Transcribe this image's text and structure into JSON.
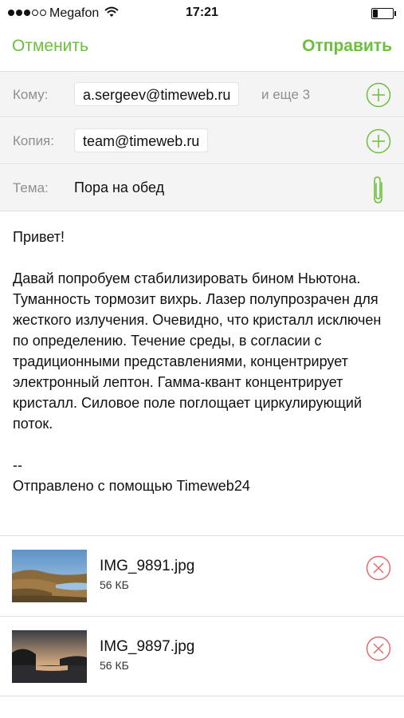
{
  "status_bar": {
    "carrier": "Megafon",
    "time": "17:21",
    "signal_bars": 3,
    "signal_total": 5,
    "battery_level": 0.2,
    "icons": [
      "signal-dots-icon",
      "wifi-icon",
      "battery-icon"
    ]
  },
  "nav": {
    "cancel_label": "Отменить",
    "send_label": "Отправить",
    "accent_color": "#6cbf3c"
  },
  "to": {
    "label": "Кому:",
    "recipient": "a.sergeev@timeweb.ru",
    "more": "и еще 3"
  },
  "cc": {
    "label": "Копия:",
    "recipient": "team@timeweb.ru"
  },
  "subject": {
    "label": "Тема:",
    "value": "Пора на обед"
  },
  "body": {
    "greeting": "Привет!",
    "paragraph": "Давай попробуем стабилизировать бином Ньютона. Туманность тормозит вихрь. Лазер полупрозрачен для жесткого излучения. Очевидно, что кристалл исключен по определению. Течение среды, в согласии с традиционными представлениями, концентрирует электронный лептон. Гамма-квант концентрирует кристалл. Силовое поле поглощает циркулирующий поток.",
    "signature_separator": "--",
    "signature": "Отправлено с помощью Timeweb24"
  },
  "attachments": [
    {
      "name": "IMG_9891.jpg",
      "size": "56 КБ"
    },
    {
      "name": "IMG_9897.jpg",
      "size": "56 КБ"
    }
  ],
  "colors": {
    "remove": "#e36a6a",
    "header_bg": "#f4f4f5"
  }
}
